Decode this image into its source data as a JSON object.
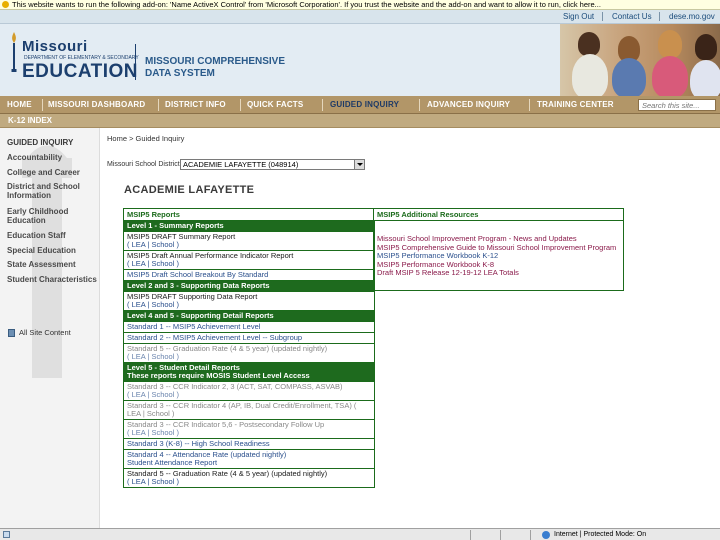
{
  "infobar": {
    "message": "This website wants to run the following add-on: 'Name ActiveX Control' from 'Microsoft Corporation'. If you trust the website and the add-on and want to allow it to run, click here..."
  },
  "topnav": {
    "signout": "Sign Out",
    "contact": "Contact Us",
    "site": "dese.mo.gov"
  },
  "logo": {
    "missouri": "Missouri",
    "dept": "DEPARTMENT OF ELEMENTARY & SECONDARY",
    "education": "EDUCATION"
  },
  "system_title": {
    "line1": "MISSOURI COMPREHENSIVE",
    "line2": "DATA SYSTEM"
  },
  "mainnav": {
    "items": [
      "HOME",
      "MISSOURI DASHBOARD",
      "DISTRICT INFO",
      "QUICK FACTS",
      "GUIDED INQUIRY",
      "ADVANCED INQUIRY",
      "TRAINING CENTER"
    ],
    "active": "GUIDED INQUIRY",
    "search_placeholder": "Search this site..."
  },
  "subnav": {
    "item": "K-12 INDEX"
  },
  "sidebar": {
    "items": [
      "GUIDED INQUIRY",
      "Accountability",
      "College and Career",
      "District and School Information",
      "Early Childhood Education",
      "Education Staff",
      "Special Education",
      "State Assessment",
      "Student Characteristics"
    ],
    "all_site": "All Site Content"
  },
  "breadcrumb": "Home > Guided Inquiry",
  "district": {
    "label": "Missouri School District:",
    "selected": "ACADEMIE LAFAYETTE (048914)"
  },
  "school_title": "ACADEMIE LAFAYETTE",
  "reports": {
    "heading": "MSIP5 Reports",
    "level1": "Level 1 - Summary Reports",
    "l1_items": [
      {
        "title": "MSIP5 DRAFT Summary Report",
        "sub": "( LEA | School )"
      },
      {
        "title": "MSIP5 Draft Annual Performance Indicator Report",
        "sub": "( LEA | School )"
      },
      {
        "title": "MSIP5 Draft School Breakout By Standard",
        "sub": ""
      }
    ],
    "level23": "Level 2 and 3 - Supporting Data Reports",
    "l23_items": [
      {
        "title": "MSIP5 DRAFT Supporting Data Report",
        "sub": "( LEA | School )"
      }
    ],
    "level45": "Level 4 and 5 - Supporting Detail Reports",
    "l45_items": [
      {
        "title": "Standard 1 -- MSIP5 Achievement Level"
      },
      {
        "title": "Standard 2 -- MSIP5 Achievement Level -- Subgroup"
      },
      {
        "title": "Standard 5 -- Graduation Rate (4 & 5 year) (updated nightly)",
        "sub": "( LEA | School )"
      }
    ],
    "level5": "Level 5 - Student Detail Reports",
    "level5_note": "These reports require MOSIS Student Level Access",
    "l5_items": [
      {
        "title": "Standard 3 -- CCR Indicator 2, 3 (ACT, SAT, COMPASS, ASVAB)",
        "sub": "( LEA | School )"
      },
      {
        "title": "Standard 3 -- CCR Indicator 4 (AP, IB, Dual Credit/Enrollment, TSA) ( LEA | School )"
      },
      {
        "title": "Standard 3 -- CCR Indicator 5,6 - Postsecondary Follow Up",
        "sub": "( LEA | School )"
      },
      {
        "title": "Standard 3 (K-8) -- High School Readiness"
      },
      {
        "title": "Standard 4 -- Attendance Rate (updated nightly)",
        "sub": "Student Attendance Report"
      },
      {
        "title": "Standard 5 -- Graduation Rate (4 & 5 year) (updated nightly)",
        "sub": "( LEA | School )"
      }
    ]
  },
  "resources": {
    "heading": "MSIP5 Additional Resources",
    "links": [
      "Missouri School Improvement Program - News and Updates",
      "MSIP5 Comprehensive Guide to Missouri School Improvement Program",
      "MSIP5 Performance Workbook K-12",
      "MSIP5 Performance Workbook K-8",
      "Draft MSIP 5 Release 12-19-12 LEA Totals"
    ]
  },
  "statusbar": {
    "zone": "Internet | Protected Mode: On"
  }
}
